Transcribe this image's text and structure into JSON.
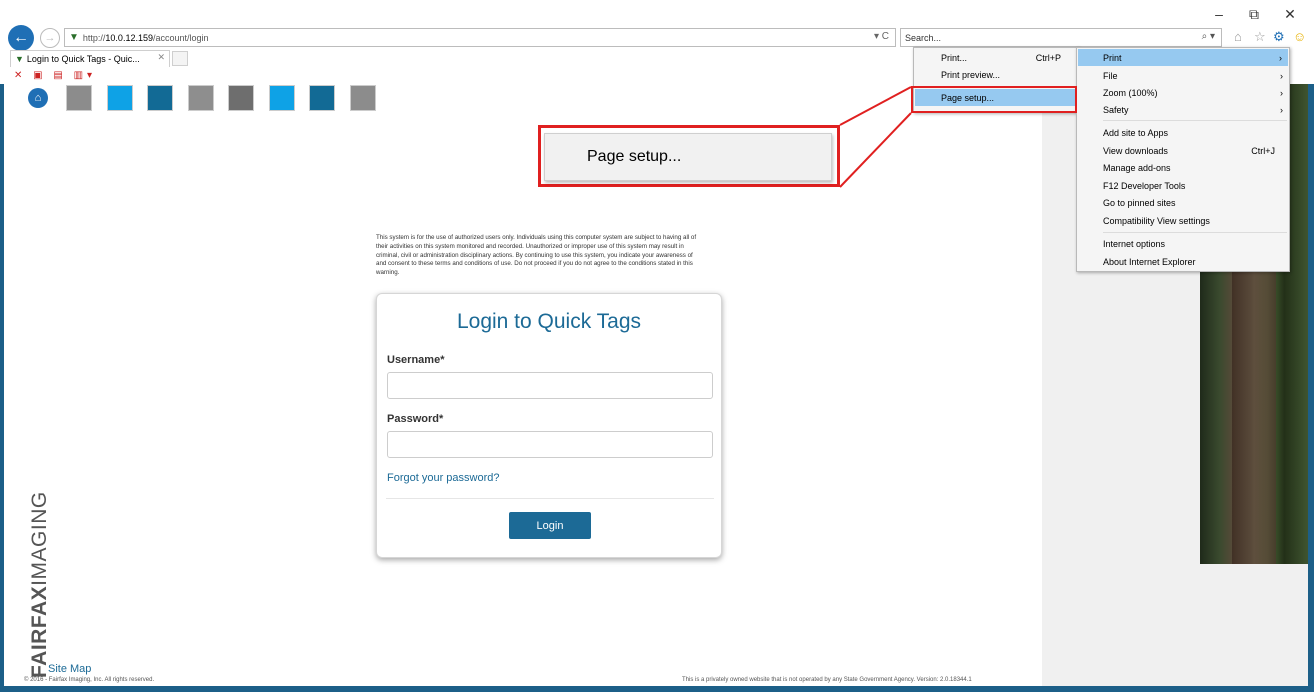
{
  "window": {
    "minimize": "–",
    "restore": "⧉",
    "close": "✕"
  },
  "address_bar": {
    "url_prefix": "http://",
    "url_host": "10.0.12.159",
    "url_path": "/account/login",
    "refresh": "▾ C"
  },
  "search": {
    "placeholder": "Search...",
    "icon": "search-icon"
  },
  "toolbar_icons": [
    "home-icon",
    "star-icon",
    "gear-icon",
    "smiley-icon"
  ],
  "tab": {
    "title": "Login to Quick Tags - Quic...",
    "close": "✕"
  },
  "tools_menu": {
    "items": [
      {
        "label": "Print",
        "submenu": true,
        "highlighted": true
      },
      {
        "label": "File",
        "submenu": true
      },
      {
        "label": "Zoom (100%)",
        "submenu": true
      },
      {
        "label": "Safety",
        "submenu": true
      },
      {
        "label": "Add site to Apps"
      },
      {
        "label": "View downloads",
        "shortcut": "Ctrl+J"
      },
      {
        "label": "Manage add-ons"
      },
      {
        "label": "F12 Developer Tools"
      },
      {
        "label": "Go to pinned sites"
      },
      {
        "label": "Compatibility View settings"
      },
      {
        "label": "Internet options"
      },
      {
        "label": "About Internet Explorer"
      }
    ]
  },
  "print_submenu": {
    "items": [
      {
        "label": "Print...",
        "shortcut": "Ctrl+P"
      },
      {
        "label": "Print preview..."
      },
      {
        "label": "Page setup...",
        "highlighted": true
      }
    ]
  },
  "callout": {
    "label": "Page setup...",
    "color": "#e02020"
  },
  "page": {
    "disclaimer": "This system is for the use of authorized users only. Individuals using this computer system are subject to having all of their activities on this system monitored and recorded. Unauthorized or improper use of this system may result in criminal, civil or administration disciplinary actions. By continuing to use this system, you indicate your awareness of and consent to these terms and conditions of use. Do not proceed if you do not agree to the conditions stated in this warning.",
    "login_title": "Login to Quick Tags",
    "username_label": "Username*",
    "password_label": "Password*",
    "forgot_link": "Forgot your password?",
    "login_button": "Login",
    "logo_bold": "FAIRFAX",
    "logo_light": "IMAGING",
    "site_map": "Site Map",
    "copyright": "© 2016 - Fairfax Imaging, Inc. All rights reserved.",
    "notice": "This is a privately owned website that is not operated by any State Government Agency. Version: 2.0.18344.1"
  },
  "colors": {
    "accent": "#1c6a96",
    "brand_blue": "#1f6fb5",
    "menu_highlight": "#96c9f0",
    "frame_border": "#1c5f88"
  },
  "tiles": [
    {
      "name": "tile-1",
      "color": "#8c8c8c"
    },
    {
      "name": "tile-2",
      "color": "#0ea2e6"
    },
    {
      "name": "tile-3",
      "color": "#126a95"
    },
    {
      "name": "tile-4",
      "color": "#8e8e8e"
    },
    {
      "name": "tile-5",
      "color": "#6e6e6e"
    },
    {
      "name": "tile-6",
      "color": "#0ea2e6"
    },
    {
      "name": "tile-7",
      "color": "#126a95"
    },
    {
      "name": "tile-8",
      "color": "#8c8c8c"
    }
  ]
}
